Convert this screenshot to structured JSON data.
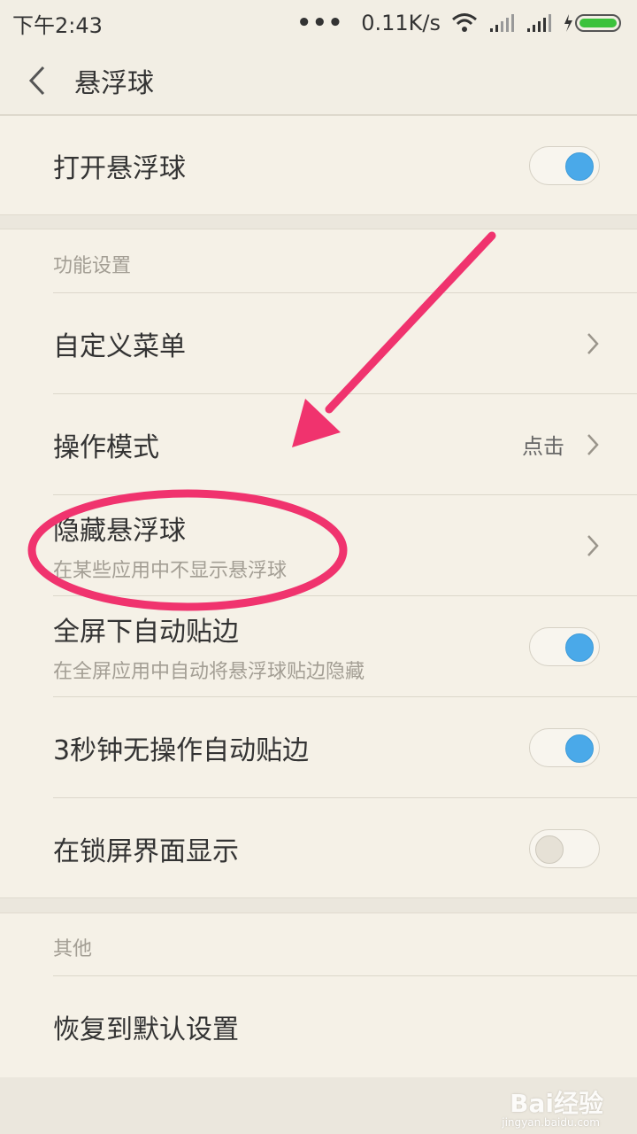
{
  "status_bar": {
    "time": "下午2:43",
    "more": "•••",
    "speed": "0.11K/s"
  },
  "header": {
    "title": "悬浮球"
  },
  "main_toggle": {
    "label": "打开悬浮球",
    "on": true
  },
  "function_section": {
    "title": "功能设置",
    "custom_menu": {
      "label": "自定义菜单"
    },
    "operation_mode": {
      "label": "操作模式",
      "value": "点击"
    },
    "hide_ball": {
      "label": "隐藏悬浮球",
      "sub": "在某些应用中不显示悬浮球"
    },
    "fullscreen_edge": {
      "label": "全屏下自动贴边",
      "sub": "在全屏应用中自动将悬浮球贴边隐藏",
      "on": true
    },
    "idle_edge": {
      "label": "3秒钟无操作自动贴边",
      "on": true
    },
    "lockscreen": {
      "label": "在锁屏界面显示",
      "on": false
    }
  },
  "other_section": {
    "title": "其他",
    "restore": {
      "label": "恢复到默认设置"
    }
  },
  "watermark": {
    "brand": "Bai经验",
    "url": "jingyan.baidu.com"
  },
  "colors": {
    "accent": "#4aa9e9",
    "annotation": "#f0336e",
    "background": "#f5f1e7"
  }
}
